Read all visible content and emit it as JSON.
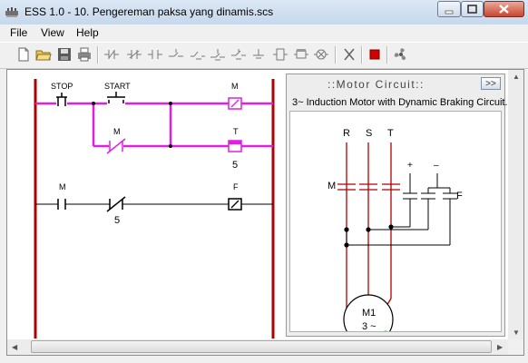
{
  "window": {
    "title": "ESS 1.0 - 10. Pengereman paksa yang dinamis.scs",
    "icon": "app-icon",
    "controls": [
      "minimize-icon",
      "maximize-icon",
      "close-icon"
    ]
  },
  "menu": {
    "items": [
      "File",
      "View",
      "Help"
    ]
  },
  "toolbar": {
    "icons": [
      "new-file-icon",
      "open-folder-icon",
      "save-icon",
      "print-icon",
      "nc-contact-icon",
      "nc-contact-alt-icon",
      "no-contact-icon",
      "timer-contact-icon",
      "coil-icon",
      "coil-alt-icon",
      "ground-icon",
      "ground-alt-icon",
      "relay-icon",
      "timer-coil-icon",
      "lamp-icon",
      "delete-icon",
      "stop-run-icon",
      "fan-icon"
    ]
  },
  "ladder": {
    "labels": {
      "stop": "STOP",
      "start": "START",
      "coil_m": "M",
      "contact_m_2": "M",
      "coil_t": "T",
      "coil_t_value": "5",
      "contact_m_3": "M",
      "contact_t_3": "T",
      "contact_t_value": "5",
      "coil_f": "F"
    },
    "colors": {
      "energized": "#e020e0",
      "rail": "#b00000",
      "wire": "#000000"
    }
  },
  "motor_panel": {
    "title": "::Motor Circuit::",
    "collapse_label": ">>",
    "subtitle": "3~ Induction Motor with Dynamic Braking Circuit.",
    "labels": {
      "r": "R",
      "s": "S",
      "t": "T",
      "m": "M",
      "plus": "+",
      "minus": "–",
      "f": "F",
      "motor_name": "M1",
      "motor_phase": "3 ~"
    },
    "colors": {
      "phase_wire": "#b00000",
      "status_dot": "#22cc22"
    }
  },
  "scrollbars": {
    "up": "▲",
    "down": "▼",
    "left": "◀",
    "right": "▶"
  }
}
